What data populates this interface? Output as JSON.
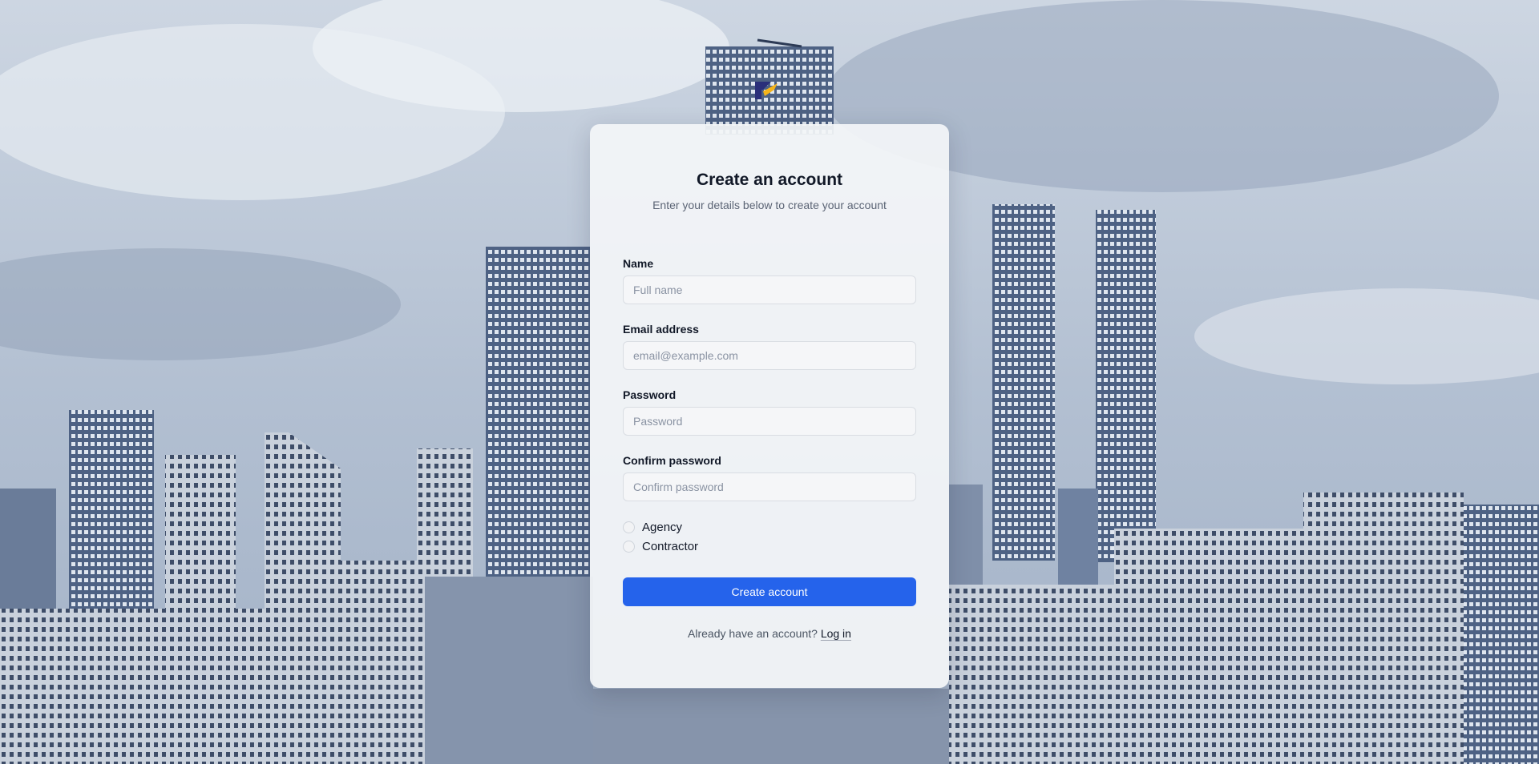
{
  "background": {
    "icon": "city-skyline-photo"
  },
  "logo": {
    "icon": "brand-logo-icon",
    "colors": [
      "#2a2f7a",
      "#f5b41a"
    ]
  },
  "form": {
    "title": "Create an account",
    "subtitle": "Enter your details below to create your account",
    "fields": [
      {
        "label": "Name",
        "placeholder": "Full name",
        "value": ""
      },
      {
        "label": "Email address",
        "placeholder": "email@example.com",
        "value": ""
      },
      {
        "label": "Password",
        "placeholder": "Password",
        "value": ""
      },
      {
        "label": "Confirm password",
        "placeholder": "Confirm password",
        "value": ""
      }
    ],
    "roles": [
      {
        "label": "Agency",
        "selected": false
      },
      {
        "label": "Contractor",
        "selected": false
      }
    ],
    "submit_label": "Create account",
    "login_prompt": "Already have an account?",
    "login_link": "Log in"
  },
  "colors": {
    "accent": "#2563eb",
    "card": "#f3f5f8",
    "text": "#111827",
    "muted": "#5b6475"
  }
}
